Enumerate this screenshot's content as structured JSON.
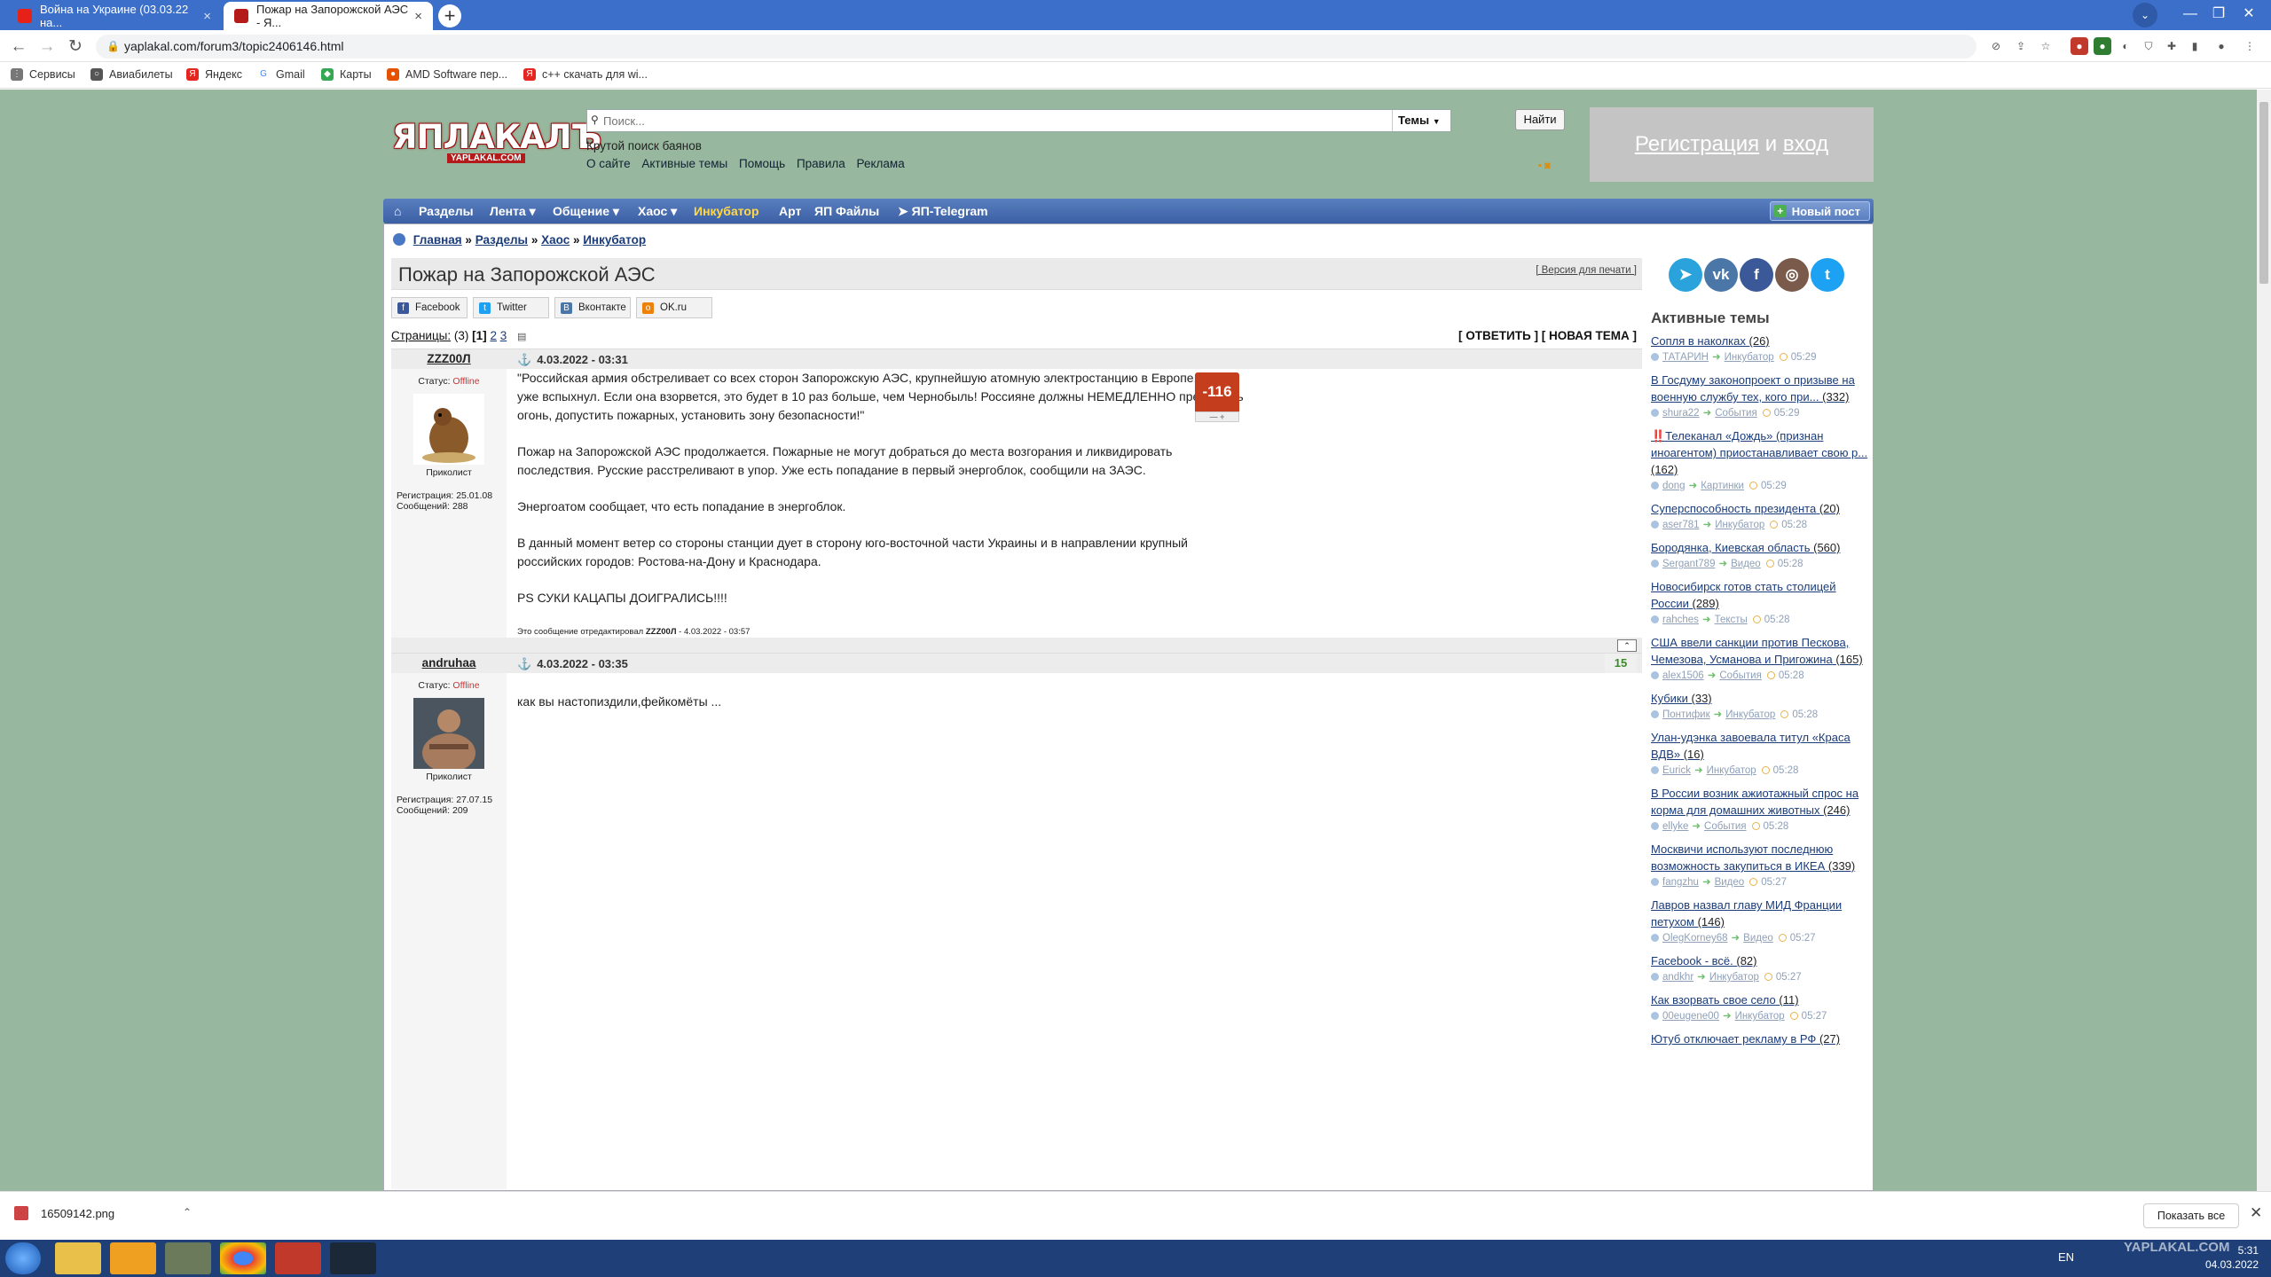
{
  "browser": {
    "tabs": [
      {
        "title": "Война на Украине (03.03.22 на..."
      },
      {
        "title": "Пожар на Запорожской АЭС - Я..."
      }
    ],
    "url": "yaplakal.com/forum3/topic2406146.html",
    "bookmarks": [
      "Сервисы",
      "Авиабилеты",
      "Яндекс",
      "Gmail",
      "Карты",
      "AMD Software пер...",
      "c++ скачать для wi..."
    ]
  },
  "site": {
    "logo_main": "ЯПЛАКАЛЪ",
    "logo_sub": "YAPLAKAL.COM",
    "search_placeholder": "Поиск...",
    "search_select": "Темы",
    "search_button": "Найти",
    "tagline": "Крутой поиск баянов",
    "top_links": [
      "О сайте",
      "Активные темы",
      "Помощь",
      "Правила",
      "Реклама"
    ],
    "register": "Регистрация",
    "register_and": "и",
    "login": "вход",
    "nav": [
      "Разделы",
      "Лента ▾",
      "Общение ▾",
      "Хаос ▾",
      "Инкубатор",
      "Арт",
      "ЯП Файлы",
      "ЯП-Telegram"
    ],
    "new_post": "Новый пост"
  },
  "breadcrumb": [
    "Главная",
    "Разделы",
    "Хаос",
    "Инкубатор"
  ],
  "topic": {
    "title": "Пожар на Запорожской АЭС",
    "print": "[ Версия для печати ]",
    "share": [
      "Facebook",
      "Twitter",
      "Вконтакте",
      "OK.ru"
    ],
    "pages_label": "Страницы:",
    "pages_count": "(3)",
    "pages": [
      "[1]",
      "2",
      "3"
    ],
    "reply": "[ ОТВЕТИТЬ ]",
    "new_topic": "[ НОВАЯ ТЕМА ]"
  },
  "posts": [
    {
      "author": "ZZZ00Л",
      "date": "4.03.2022 - 03:31",
      "status_label": "Статус:",
      "status": "Offline",
      "rank": "Приколист",
      "reg": "Регистрация: 25.01.08",
      "msgs": "Сообщений: 288",
      "karma": "-116",
      "paragraphs": [
        "\"Российская армия обстреливает со всех сторон Запорожскую АЭС, крупнейшую атомную электростанцию в Европе. Огонь уже вспыхнул. Если она взорвется, это будет в 10 раз больше, чем Чернобыль! Россияне должны НЕМЕДЛЕННО прекратить огонь, допустить пожарных, установить зону безопасности!\"",
        "Пожар на Запорожской АЭС продолжается. Пожарные не могут добраться до места возгорания и ликвидировать последствия. Русские расстреливают в упор. Уже есть попадание в первый энергоблок, сообщили на ЗАЭС.",
        "Энергоатом сообщает, что есть попадание в энергоблок.",
        "В данный момент ветер со стороны станции дует в сторону юго-восточной части Украины и в направлении крупный российских городов: Ростова-на-Дону и Краснодара.",
        "PS СУКИ КАЦАПЫ ДОИГРАЛИСЬ!!!!"
      ],
      "edited_prefix": "Это сообщение отредактировал",
      "edited_by": "ZZZ00Л",
      "edited_at": "- 4.03.2022 - 03:57"
    },
    {
      "author": "andruhaa",
      "date": "4.03.2022 - 03:35",
      "status_label": "Статус:",
      "status": "Offline",
      "rank": "Приколист",
      "reg": "Регистрация: 27.07.15",
      "msgs": "Сообщений: 209",
      "score": "15",
      "paragraphs": [
        "как вы настопиздили,фейкомёты ..."
      ]
    }
  ],
  "sidebar": {
    "active_title": "Активные темы",
    "topics": [
      {
        "title": "Сопля в наколках",
        "count": "(26)",
        "user": "ТАТАРИН",
        "section": "Инкубатор",
        "time": "05:29"
      },
      {
        "title": "В Госдуму законопроект о призыве на военную службу тех, кого при...",
        "count": "(332)",
        "user": "shura22",
        "section": "События",
        "time": "05:29"
      },
      {
        "title": "‼️Телеканал «Дождь» (признан иноагентом) приостанавливает свою р...",
        "count": "(162)",
        "user": "dong",
        "section": "Картинки",
        "time": "05:29"
      },
      {
        "title": "Суперспособность президента",
        "count": "(20)",
        "user": "aser781",
        "section": "Инкубатор",
        "time": "05:28"
      },
      {
        "title": "Бородянка, Киевская область",
        "count": "(560)",
        "user": "Sergant789",
        "section": "Видео",
        "time": "05:28"
      },
      {
        "title": "Новосибирск готов стать столицей России",
        "count": "(289)",
        "user": "rahches",
        "section": "Тексты",
        "time": "05:28"
      },
      {
        "title": "США ввели санкции против Пескова, Чемезова, Усманова и Пригожина",
        "count": "(165)",
        "user": "alex1506",
        "section": "События",
        "time": "05:28"
      },
      {
        "title": "Кубики",
        "count": "(33)",
        "user": "Понтифик",
        "section": "Инкубатор",
        "time": "05:28"
      },
      {
        "title": "Улан-удэнка завоевала титул «Краса ВДВ»",
        "count": "(16)",
        "user": "Eurick",
        "section": "Инкубатор",
        "time": "05:28"
      },
      {
        "title": "В России возник ажиотажный спрос на корма для домашних животных",
        "count": "(246)",
        "user": "ellyke",
        "section": "События",
        "time": "05:28"
      },
      {
        "title": "Москвичи используют последнюю возможность закупиться в ИКЕА",
        "count": "(339)",
        "user": "fangzhu",
        "section": "Видео",
        "time": "05:27"
      },
      {
        "title": "Лавров назвал главу МИД Франции петухом",
        "count": "(146)",
        "user": "OlegKorney68",
        "section": "Видео",
        "time": "05:27"
      },
      {
        "title": "Facebook - всё.",
        "count": "(82)",
        "user": "andkhr",
        "section": "Инкубатор",
        "time": "05:27"
      },
      {
        "title": "Как взорвать свое село",
        "count": "(11)",
        "user": "00eugene00",
        "section": "Инкубатор",
        "time": "05:27"
      },
      {
        "title": "Ютуб отключает рекламу в РФ",
        "count": "(27)",
        "user": "",
        "section": "",
        "time": ""
      }
    ]
  },
  "downloads": {
    "file": "16509142.png",
    "show_all": "Показать все"
  },
  "taskbar": {
    "lang": "EN",
    "time": "5:31",
    "date": "04.03.2022",
    "watermark": "YAPLAKAL.COM"
  },
  "colors": {
    "page_bg": "#97b89e",
    "nav_bg": "#3b5fa3",
    "logo_red": "#cc1c1c",
    "karma_neg": "#c43d1c",
    "tabbar": "#3b6fc9"
  }
}
